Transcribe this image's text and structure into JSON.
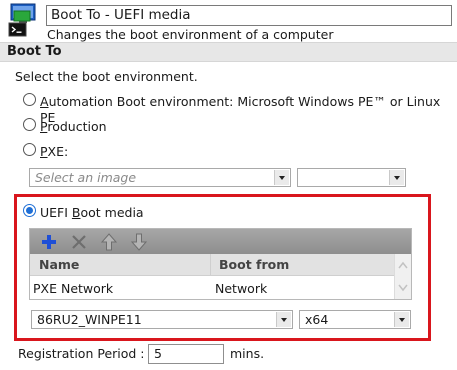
{
  "header": {
    "title": "Boot To - UEFI media",
    "subtitle": "Changes the boot environment of a computer"
  },
  "section": {
    "title": "Boot To",
    "instruction": "Select the boot environment."
  },
  "options": {
    "automation": {
      "mnemonic": "A",
      "rest": "utomation Boot environment: Microsoft Windows PE™ or Linux PE"
    },
    "production": {
      "mnemonic": "P",
      "rest": "roduction"
    },
    "pxe": {
      "mnemonic": "P",
      "rest": "XE:"
    },
    "uefi": {
      "prefix": "UEFI ",
      "mnemonic": "B",
      "rest": "oot media"
    }
  },
  "pxe_image_select": {
    "placeholder": "Select an image",
    "value": ""
  },
  "pxe_arch_select": {
    "value": ""
  },
  "grid": {
    "toolbar_icons": [
      "add-icon",
      "delete-icon",
      "move-up-icon",
      "move-down-icon"
    ],
    "columns": [
      "Name",
      "Boot from"
    ],
    "rows": [
      {
        "name": "PXE Network",
        "boot_from": "Network"
      }
    ]
  },
  "uefi_image_select": {
    "value": "86RU2_WINPE11"
  },
  "uefi_arch_select": {
    "value": "x64"
  },
  "registration": {
    "label": "Registration Period :",
    "value": "5",
    "unit": "mins."
  },
  "colors": {
    "highlight_frame": "#d9161d",
    "accent_blue": "#1f6fd6"
  }
}
